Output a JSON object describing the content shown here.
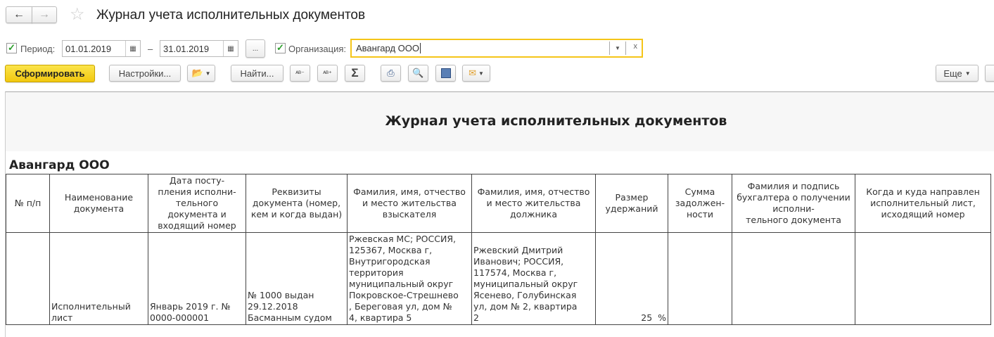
{
  "window": {
    "title": "Журнал учета исполнительных документов"
  },
  "filters": {
    "period_label": "Период:",
    "date_from": "01.01.2019",
    "dash": "–",
    "date_to": "31.01.2019",
    "period_button": "...",
    "org_label": "Организация:",
    "org_value": "Авангард ООО",
    "period_checked": true,
    "org_checked": true
  },
  "toolbar": {
    "generate": "Сформировать",
    "settings": "Настройки...",
    "find": "Найти...",
    "more": "Еще"
  },
  "report": {
    "title": "Журнал учета исполнительных документов",
    "org": "Авангард ООО",
    "headers": [
      "№ п/п",
      "Наименование\nдокумента",
      "Дата посту-\nпления исполни-\nтельного\nдокумента и\nвходящий номер",
      "Реквизиты\nдокумента (номер,\nкем и когда выдан)",
      "Фамилия, имя, отчество\nи место жительства\nвзыскателя",
      "Фамилия, имя, отчество\nи место жительства\nдолжника",
      "Размер\nудержаний",
      "Сумма\nзадолжен-\nности",
      "Фамилия и подпись\nбухгалтера о получении\nисполни-\nтельного документа",
      "Когда и куда направлен\nисполнительный лист,\nисходящий номер"
    ],
    "rows": [
      [
        "",
        "Исполнительный\nлист",
        "Январь 2019 г. №\n0000-000001",
        "№ 1000 выдан\n29.12.2018\nБасманным судом",
        "Ржевская МС; РОССИЯ,\n125367, Москва г,\nВнутригородская\nтерритория\nмуниципальный округ\nПокровское-Стрешнево\n, Береговая ул, дом №\n4, квартира 5",
        "Ржевский Дмитрий\nИванович; РОССИЯ,\n117574, Москва г,\nмуниципальный округ\nЯсенево, Голубинская\nул, дом № 2, квартира\n2",
        "25  %",
        "",
        "",
        ""
      ]
    ]
  }
}
